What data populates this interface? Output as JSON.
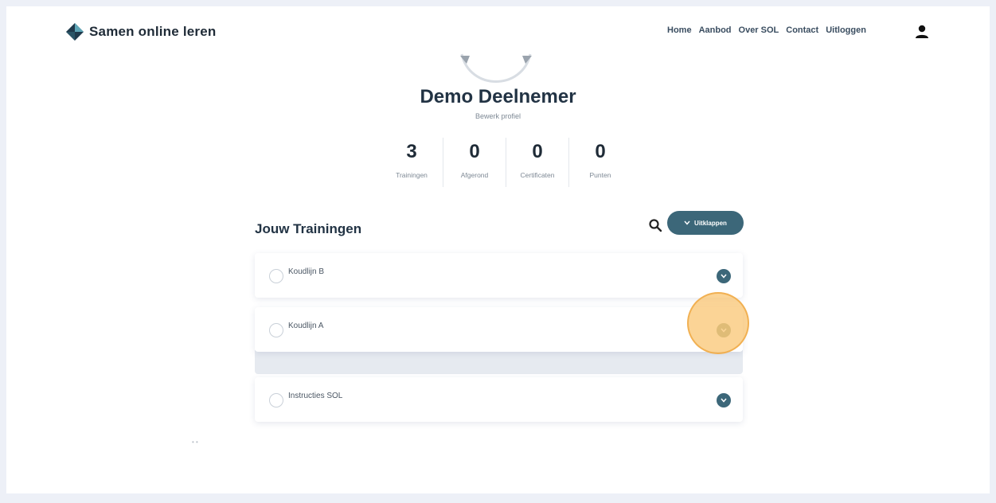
{
  "header": {
    "brand": "Samen online leren",
    "nav": [
      "Home",
      "Aanbod",
      "Over SOL",
      "Contact",
      "Uitloggen"
    ],
    "icons": {
      "logo": "diamond-logo-icon",
      "user": "user-icon"
    }
  },
  "profile": {
    "name": "Demo Deelnemer",
    "edit_label": "Bewerk profiel"
  },
  "stats": [
    {
      "value": "3",
      "label": "Trainingen"
    },
    {
      "value": "0",
      "label": "Afgerond"
    },
    {
      "value": "0",
      "label": "Certificaten"
    },
    {
      "value": "0",
      "label": "Punten"
    }
  ],
  "trainings": {
    "title": "Jouw Trainingen",
    "collapse_label": "Uitklappen",
    "items": [
      {
        "name": "Koudlijn B"
      },
      {
        "name": "Koudlijn A"
      },
      {
        "name": "Instructies SOL"
      }
    ]
  },
  "footer_dots": "• •",
  "colors": {
    "accent": "#3c6779",
    "highlight": "#fac46e",
    "background": "#edf0f7"
  }
}
